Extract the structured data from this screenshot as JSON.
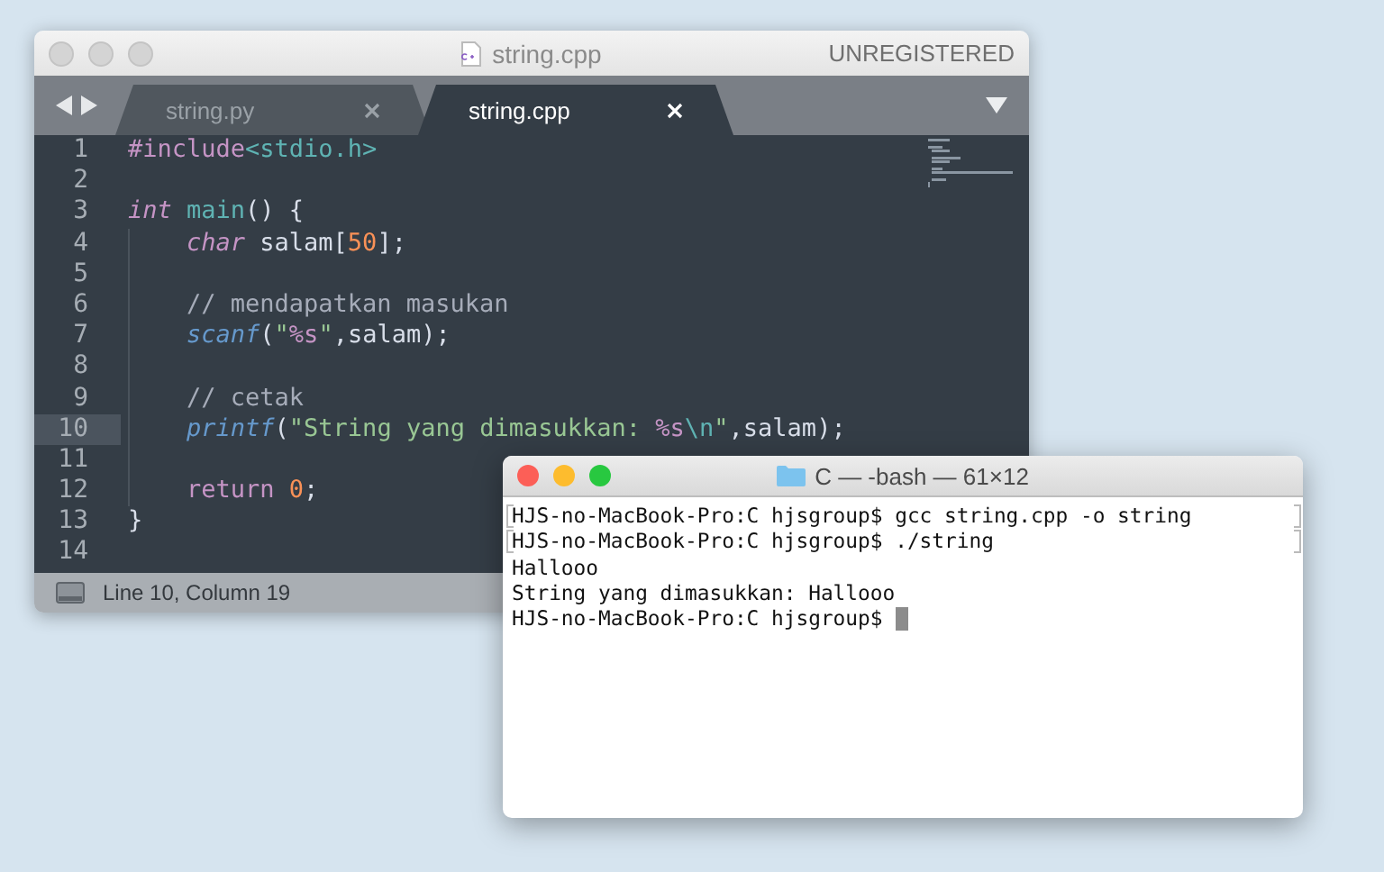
{
  "editor": {
    "title": "string.cpp",
    "license": "UNREGISTERED",
    "tabs": [
      {
        "label": "string.py",
        "selected": false
      },
      {
        "label": "string.cpp",
        "selected": true
      }
    ],
    "lines": [
      {
        "number": "1",
        "current": false,
        "indented": false,
        "tokens": [
          {
            "t": "#include",
            "kind": "keyword"
          },
          {
            "t": "<stdio.h>",
            "kind": "name"
          }
        ]
      },
      {
        "number": "2",
        "current": false,
        "indented": false
      },
      {
        "number": "3",
        "current": false,
        "indented": false,
        "tokens": [
          {
            "t": "int",
            "kind": "type"
          },
          {
            "t": " main",
            "kind": "name"
          },
          {
            "t": "() {",
            "kind": "plain"
          }
        ]
      },
      {
        "number": "4",
        "current": false,
        "indented": true,
        "tokens": [
          {
            "t": "char",
            "kind": "type"
          },
          {
            "t": " salam[",
            "kind": "plain"
          },
          {
            "t": "50",
            "kind": "number"
          },
          {
            "t": "];",
            "kind": "plain"
          }
        ]
      },
      {
        "number": "5",
        "current": false,
        "indented": false
      },
      {
        "number": "6",
        "current": false,
        "indented": true,
        "tokens": [
          {
            "t": "// mendapatkan masukan",
            "kind": "comment"
          }
        ]
      },
      {
        "number": "7",
        "current": false,
        "indented": true,
        "tokens": [
          {
            "t": "scanf",
            "kind": "function"
          },
          {
            "t": "(",
            "kind": "plain"
          },
          {
            "t": "\"",
            "kind": "string"
          },
          {
            "t": "%s",
            "kind": "keyword"
          },
          {
            "t": "\"",
            "kind": "string"
          },
          {
            "t": ",salam);",
            "kind": "plain"
          }
        ]
      },
      {
        "number": "8",
        "current": false,
        "indented": false
      },
      {
        "number": "9",
        "current": false,
        "indented": true,
        "tokens": [
          {
            "t": "// cetak",
            "kind": "comment"
          }
        ]
      },
      {
        "number": "10",
        "current": true,
        "indented": true,
        "tokens": [
          {
            "t": "printf",
            "kind": "function"
          },
          {
            "t": "(",
            "kind": "plain"
          },
          {
            "t": "\"String yang dimasukkan: ",
            "kind": "string"
          },
          {
            "t": "%s",
            "kind": "keyword"
          },
          {
            "t": "\\n",
            "kind": "name"
          },
          {
            "t": "\"",
            "kind": "string"
          },
          {
            "t": ",salam);",
            "kind": "plain"
          }
        ]
      },
      {
        "number": "11",
        "current": false,
        "indented": false
      },
      {
        "number": "12",
        "current": false,
        "indented": true,
        "tokens": [
          {
            "t": "return",
            "kind": "keyword"
          },
          {
            "t": " 0",
            "kind": "number"
          },
          {
            "t": ";",
            "kind": "plain"
          }
        ]
      },
      {
        "number": "13",
        "current": false,
        "indented": false,
        "tokens": [
          {
            "t": "}",
            "kind": "plain"
          }
        ]
      },
      {
        "number": "14",
        "current": false,
        "indented": false
      }
    ],
    "status": "Line 10, Column 19"
  },
  "terminal": {
    "title": "C — -bash — 61×12",
    "lines": [
      {
        "text": "HJS-no-MacBook-Pro:C hjsgroup$ gcc string.cpp -o string",
        "marked": true,
        "cursor": false
      },
      {
        "text": "HJS-no-MacBook-Pro:C hjsgroup$ ./string",
        "marked": true,
        "cursor": false
      },
      {
        "text": "Hallooo",
        "marked": false,
        "cursor": false
      },
      {
        "text": "String yang dimasukkan: Hallooo",
        "marked": false,
        "cursor": false
      },
      {
        "text": "HJS-no-MacBook-Pro:C hjsgroup$",
        "marked": false,
        "cursor": true
      }
    ]
  }
}
